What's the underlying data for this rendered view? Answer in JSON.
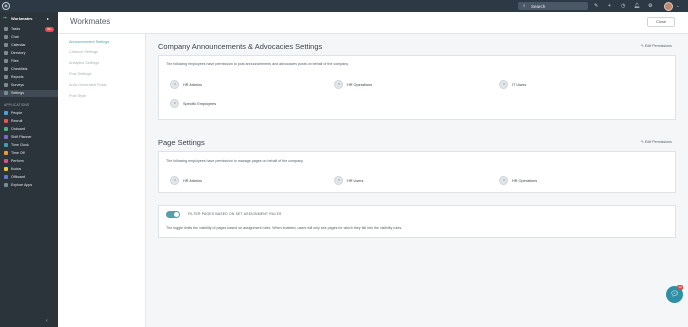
{
  "topbar": {
    "search_placeholder": "Search",
    "icons": [
      "logo-icon",
      "search-icon",
      "pencil-icon",
      "plus-icon",
      "clock-icon",
      "bell-icon",
      "gear-icon",
      "avatar",
      "chevron-down-icon"
    ]
  },
  "sidebar": {
    "header": "Workmates",
    "items": [
      {
        "label": "Tasks",
        "badge": "99+",
        "color": "#7a8a97"
      },
      {
        "label": "Chat",
        "color": "#7a8a97"
      },
      {
        "label": "Calendar",
        "color": "#7a8a97"
      },
      {
        "label": "Directory",
        "color": "#7a8a97"
      },
      {
        "label": "Files",
        "color": "#7a8a97"
      },
      {
        "label": "Checklists",
        "color": "#7a8a97"
      },
      {
        "label": "Reports",
        "color": "#7a8a97"
      },
      {
        "label": "Surveys",
        "color": "#7a8a97"
      },
      {
        "label": "Settings",
        "color": "#7a8a97"
      }
    ],
    "apps_section": "APPLICATIONS",
    "apps": [
      {
        "label": "People",
        "color": "#4aa3d8"
      },
      {
        "label": "Recruit",
        "color": "#e0564b"
      },
      {
        "label": "Onboard",
        "color": "#48b27a"
      },
      {
        "label": "Shift Planner",
        "color": "#8a63c9"
      },
      {
        "label": "Time Clock",
        "color": "#3aa0b2"
      },
      {
        "label": "Time Off",
        "color": "#e59b3a"
      },
      {
        "label": "Perform",
        "color": "#d94f8a"
      },
      {
        "label": "Kudos",
        "color": "#f0c23b"
      },
      {
        "label": "Offboard",
        "color": "#5d7bd6"
      },
      {
        "label": "Explore Apps",
        "color": "#7a8a97"
      }
    ]
  },
  "page": {
    "title": "Workmates",
    "close_label": "Close"
  },
  "subnav": {
    "items": [
      "Announcement Settings",
      "Channel Settings",
      "Analytics Settings",
      "Post Settings",
      "Auto-Generated Posts",
      "Post Style"
    ]
  },
  "announcements": {
    "title": "Company Announcements & Advocacies Settings",
    "edit_label": "Edit Permissions",
    "description": "The following employees have permission to post announcements and advocacies posts on behalf of the company.",
    "people": [
      "HR Admins",
      "HR Operations",
      "IT Users",
      "Specific Employees"
    ]
  },
  "pages": {
    "title": "Page Settings",
    "edit_label": "Edit Permissions",
    "description": "The following employees have permission to manage pages on behalf of the company.",
    "people": [
      "HR Admins",
      "HR Users",
      "HR Operations"
    ],
    "filter_label": "FILTER PAGES BASED ON SET ASSIGNMENT RULES",
    "filter_description": "The toggle limits the visibility of pages based on assignment rules. When enabled, users will only see pages for which they fall into the visibility rules.",
    "filter_enabled": true
  },
  "chat": {
    "badge": "10"
  },
  "colors": {
    "accent": "#4fa3a8",
    "topbar": "#2d3a45",
    "sidebar": "#2b333b"
  }
}
